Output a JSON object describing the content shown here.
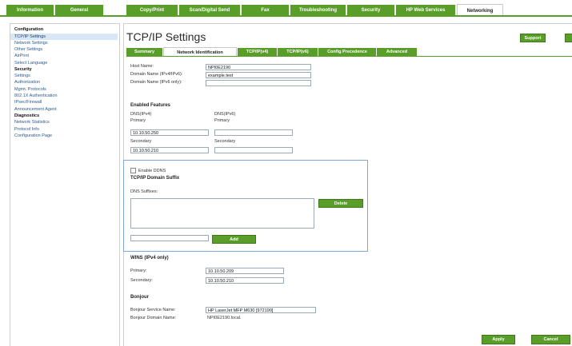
{
  "top_tabs": [
    "Information",
    "General",
    "Copy/Print",
    "Scan/Digital Send",
    "Fax",
    "Troubleshooting",
    "Security",
    "HP Web Services",
    "Networking"
  ],
  "sidebar": {
    "items": [
      {
        "label": "Configuration",
        "type": "head"
      },
      {
        "label": "TCP/IP Settings",
        "type": "selected"
      },
      {
        "label": "Network Settings",
        "type": "link"
      },
      {
        "label": "Other Settings",
        "type": "link"
      },
      {
        "label": "AirPrint",
        "type": "link"
      },
      {
        "label": "Select Language",
        "type": "link"
      },
      {
        "label": "Security",
        "type": "head"
      },
      {
        "label": "Settings",
        "type": "link"
      },
      {
        "label": "Authorization",
        "type": "link"
      },
      {
        "label": "Mgmt. Protocols",
        "type": "link"
      },
      {
        "label": "802.1X Authentication",
        "type": "link"
      },
      {
        "label": "IPsec/Firewall",
        "type": "link"
      },
      {
        "label": "Announcement Agent",
        "type": "link"
      },
      {
        "label": "Diagnostics",
        "type": "head"
      },
      {
        "label": "Network Statistics",
        "type": "link"
      },
      {
        "label": "Protocol Info",
        "type": "link"
      },
      {
        "label": "Configuration Page",
        "type": "link"
      }
    ]
  },
  "page_title": "TCP/IP Settings",
  "support_label": "Support",
  "sub_tabs": [
    "Summary",
    "Network Identification",
    "TCP/IP(v4)",
    "TCP/IP(v6)",
    "Config Precedence",
    "Advanced"
  ],
  "host": {
    "host_name_label": "Host Name:",
    "host_name_value": "NPI0E2190",
    "domain_v4_label": "Domain Name (IPv4/IPv6):",
    "domain_v4_value": "example.test",
    "domain_v6_label": "Domain Name (IPv6 only):",
    "domain_v6_value": ""
  },
  "enabled_features": {
    "title": "Enabled Features",
    "dns_v4_label": "DNS(IPv4)",
    "dns_v6_label": "DNS(IPv6)",
    "primary_label": "Primary",
    "secondary_label": "Secondary",
    "v4_primary": "10.10.50.250",
    "v4_secondary": "10.10.50.210",
    "v6_primary": "",
    "v6_secondary": ""
  },
  "ddns": {
    "enable_label": "Enable DDNS",
    "suffix_title": "TCP/IP Domain Suffix",
    "dns_suffixes_label": "DNS Suffixes:",
    "delete_label": "Delete",
    "add_label": "Add",
    "new_suffix_value": ""
  },
  "wins": {
    "title": "WINS (IPv4 only)",
    "primary_label": "Primary:",
    "primary_value": "10.10.50.209",
    "secondary_label": "Secondary:",
    "secondary_value": "10.10.50.210"
  },
  "bonjour": {
    "title": "Bonjour",
    "service_name_label": "Bonjour Service Name:",
    "service_name_value": "HP LaserJet MFP M630 [972190]",
    "domain_name_label": "Bonjour Domain Name:",
    "domain_name_value": "NPI0E2190.local."
  },
  "footer": {
    "apply_label": "Apply",
    "cancel_label": "Cancel"
  },
  "colors": {
    "accent": "#5a9e2a",
    "box_border": "#7fa8d8",
    "link": "#2b5a8a"
  }
}
